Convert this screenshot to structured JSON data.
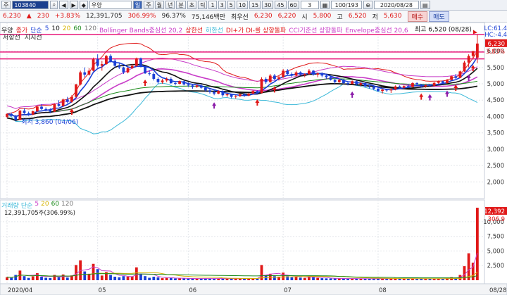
{
  "toolbar": {
    "code": "103840",
    "market_label": "주",
    "name": "우양",
    "period_active": "일",
    "periods": [
      "주",
      "월",
      "년",
      "분",
      "초",
      "틱"
    ],
    "intervals": [
      "1",
      "3",
      "5",
      "10",
      "15",
      "30",
      "45",
      "60"
    ],
    "count": "3",
    "page": "100/193",
    "date": "2020/08/28",
    "nav_tools": [
      "◀",
      "▶",
      "◆",
      "⊕"
    ]
  },
  "price": {
    "current": "6,230",
    "change_arrow": "▲",
    "change": "230",
    "change_pct": "+3.83%",
    "volume": "12,391,705",
    "volume_ratio": "306.99%",
    "strength": "96.37%",
    "amount": "75,146백만",
    "best_sell_label": "최우선",
    "best_sell": "6,230",
    "best_buy": "6,220",
    "open_label": "시",
    "open": "5,800",
    "high_label": "고",
    "high": "6,520",
    "low_label": "저",
    "low": "5,630",
    "buy_button": "매수",
    "sell_button": "매도"
  },
  "legend": {
    "name": "우양",
    "items": [
      {
        "label": "종가",
        "color": "#e01818"
      },
      {
        "label": "단순",
        "color": "#1a3fd6"
      },
      {
        "label": "5",
        "color": "#1a3fd6"
      },
      {
        "label": "10",
        "color": "#111111"
      },
      {
        "label": "20",
        "color": "#d6b300"
      },
      {
        "label": "60",
        "color": "#1b8a1b"
      },
      {
        "label": "120",
        "color": "#777777"
      },
      {
        "label": "Bollinger Bands중심선 20,2",
        "color": "#c83cc8"
      },
      {
        "label": "상한선",
        "color": "#e01818"
      },
      {
        "label": "하한선",
        "color": "#3ab8d8"
      },
      {
        "label": "DI+가 DI-를 상향돌파",
        "color": "#e01818"
      },
      {
        "label": "CCI기준선 상향돌파",
        "color": "#c83cc8"
      },
      {
        "label": "Envelope중심선 20,6",
        "color": "#c83cc8"
      }
    ],
    "sub": [
      "저항선",
      "지지선"
    ],
    "right_edge": "LC:61.4",
    "right_edge2": "HC:-4.4"
  },
  "annotations": {
    "high_label": "최고 6,520 (08/28)",
    "low_label": "최저 3,860 (04/06)",
    "price_tag": "6,230",
    "pct_tag": "3.83%"
  },
  "y_axis": {
    "price_ticks": [
      "6,000",
      "5,500",
      "5,000",
      "4,500",
      "4,000",
      "3,500",
      "3,000",
      "2,500",
      "2,000"
    ],
    "volume_ticks": [
      "10,000",
      "7,500",
      "5,000",
      "2,500"
    ],
    "volume_tag": "12,392",
    "volume_pct_tag": "306.9"
  },
  "x_axis": {
    "ticks": [
      "2020/04",
      "05",
      "06",
      "07",
      "08",
      "08/28"
    ]
  },
  "volume_legend": {
    "items": [
      {
        "label": "거래량",
        "color": "#3ab8d8"
      },
      {
        "label": "단순",
        "color": "#3ab8d8"
      },
      {
        "label": "5",
        "color": "#c83cc8"
      },
      {
        "label": "20",
        "color": "#d6b300"
      },
      {
        "label": "60",
        "color": "#1b8a1b"
      },
      {
        "label": "120",
        "color": "#777777"
      }
    ],
    "value": "12,391,705주(306.99%)"
  },
  "chart_data": {
    "type": "candlestick",
    "x_start": "2020/04/01",
    "x_end": "2020/08/28",
    "ylim": [
      1600,
      6700
    ],
    "volume_ylim": [
      0,
      13000
    ],
    "candles": [
      [
        3990,
        4100,
        3950,
        4080,
        "up",
        520
      ],
      [
        4080,
        4120,
        4000,
        4020,
        "down",
        410
      ],
      [
        4020,
        4050,
        3860,
        3900,
        "down",
        900
      ],
      [
        3900,
        4200,
        3880,
        4180,
        "up",
        1650
      ],
      [
        4180,
        4260,
        4080,
        4100,
        "down",
        700
      ],
      [
        4100,
        4150,
        4020,
        4060,
        "down",
        400
      ],
      [
        4060,
        4180,
        4040,
        4160,
        "up",
        650
      ],
      [
        4160,
        4330,
        4140,
        4300,
        "up",
        1200
      ],
      [
        4300,
        4380,
        4200,
        4230,
        "down",
        600
      ],
      [
        4230,
        4280,
        4150,
        4200,
        "down",
        420
      ],
      [
        4200,
        4250,
        4100,
        4150,
        "down",
        380
      ],
      [
        4150,
        4400,
        4140,
        4380,
        "up",
        900
      ],
      [
        4380,
        4500,
        4300,
        4320,
        "down",
        520
      ],
      [
        4320,
        4550,
        4300,
        4520,
        "up",
        980
      ],
      [
        4520,
        4600,
        4400,
        4450,
        "down",
        450
      ],
      [
        4450,
        4650,
        4420,
        4600,
        "up",
        820
      ],
      [
        4600,
        5000,
        4580,
        4980,
        "up",
        2600
      ],
      [
        4980,
        5400,
        4950,
        5350,
        "up",
        3400
      ],
      [
        5350,
        5500,
        5200,
        5280,
        "down",
        1500
      ],
      [
        5280,
        5480,
        5250,
        5400,
        "up",
        1100
      ],
      [
        5400,
        5800,
        5380,
        5750,
        "up",
        2800
      ],
      [
        5750,
        5900,
        5500,
        5550,
        "down",
        1900
      ],
      [
        5550,
        5700,
        5400,
        5600,
        "up",
        800
      ],
      [
        5600,
        5880,
        5580,
        5850,
        "up",
        1400
      ],
      [
        5850,
        5900,
        5650,
        5700,
        "down",
        900
      ],
      [
        5700,
        5750,
        5500,
        5550,
        "down",
        600
      ],
      [
        5550,
        5650,
        5450,
        5500,
        "down",
        500
      ],
      [
        5500,
        5520,
        5300,
        5350,
        "down",
        700
      ],
      [
        5350,
        5500,
        5320,
        5480,
        "up",
        600
      ],
      [
        5480,
        5600,
        5450,
        5550,
        "up",
        650
      ],
      [
        5550,
        5800,
        5520,
        5780,
        "up",
        2200
      ],
      [
        5780,
        5800,
        5500,
        5520,
        "down",
        1100
      ],
      [
        5520,
        5550,
        5300,
        5320,
        "down",
        700
      ],
      [
        5320,
        5420,
        5250,
        5300,
        "down",
        420
      ],
      [
        5300,
        5350,
        5100,
        5150,
        "down",
        600
      ],
      [
        5150,
        5200,
        5000,
        5050,
        "down",
        480
      ],
      [
        5050,
        5150,
        5000,
        5100,
        "up",
        350
      ],
      [
        5100,
        5200,
        5050,
        5150,
        "up",
        400
      ],
      [
        5150,
        5200,
        5000,
        5020,
        "down",
        380
      ],
      [
        5020,
        5080,
        4950,
        5000,
        "down",
        300
      ],
      [
        5000,
        5100,
        4980,
        5080,
        "up",
        320
      ],
      [
        5080,
        5100,
        4950,
        4980,
        "down",
        300
      ],
      [
        4980,
        5050,
        4900,
        4950,
        "down",
        280
      ],
      [
        4950,
        5000,
        4850,
        4900,
        "down",
        300
      ],
      [
        4900,
        4980,
        4880,
        4950,
        "up",
        260
      ],
      [
        4950,
        5000,
        4850,
        4880,
        "down",
        280
      ],
      [
        4880,
        4900,
        4750,
        4800,
        "down",
        320
      ],
      [
        4800,
        4850,
        4700,
        4750,
        "down",
        260
      ],
      [
        4750,
        4800,
        4650,
        4700,
        "down",
        300
      ],
      [
        4700,
        4800,
        4680,
        4780,
        "up",
        280
      ],
      [
        4780,
        4800,
        4600,
        4650,
        "down",
        310
      ],
      [
        4650,
        4700,
        4600,
        4680,
        "up",
        260
      ],
      [
        4680,
        4700,
        4550,
        4600,
        "down",
        280
      ],
      [
        4600,
        4650,
        4550,
        4620,
        "up",
        250
      ],
      [
        4620,
        4700,
        4600,
        4680,
        "up",
        300
      ],
      [
        4680,
        4720,
        4600,
        4640,
        "down",
        260
      ],
      [
        4640,
        4720,
        4620,
        4700,
        "up",
        280
      ],
      [
        4700,
        4800,
        4680,
        4780,
        "up",
        350
      ],
      [
        4780,
        4800,
        4700,
        4720,
        "down",
        280
      ],
      [
        4720,
        5200,
        4700,
        5150,
        "up",
        2600
      ],
      [
        5150,
        5200,
        5000,
        5050,
        "down",
        900
      ],
      [
        5050,
        5300,
        5030,
        5250,
        "up",
        1100
      ],
      [
        5250,
        5300,
        5100,
        5150,
        "down",
        700
      ],
      [
        5150,
        5250,
        5100,
        5200,
        "up",
        600
      ],
      [
        5200,
        5450,
        5180,
        5400,
        "up",
        1300
      ],
      [
        5400,
        5450,
        5250,
        5300,
        "down",
        700
      ],
      [
        5300,
        5350,
        5200,
        5250,
        "down",
        500
      ],
      [
        5250,
        5400,
        5230,
        5350,
        "up",
        600
      ],
      [
        5350,
        5380,
        5250,
        5280,
        "down",
        450
      ],
      [
        5280,
        5320,
        5200,
        5300,
        "up",
        380
      ],
      [
        5300,
        5450,
        5280,
        5400,
        "up",
        800
      ],
      [
        5400,
        5420,
        5250,
        5280,
        "down",
        500
      ],
      [
        5280,
        5350,
        5200,
        5320,
        "up",
        400
      ],
      [
        5320,
        5350,
        5200,
        5250,
        "down",
        350
      ],
      [
        5250,
        5300,
        5150,
        5200,
        "down",
        320
      ],
      [
        5200,
        5250,
        5100,
        5120,
        "down",
        300
      ],
      [
        5120,
        5150,
        5000,
        5050,
        "down",
        320
      ],
      [
        5050,
        5150,
        5030,
        5120,
        "up",
        280
      ],
      [
        5120,
        5150,
        5000,
        5020,
        "down",
        300
      ],
      [
        5020,
        5080,
        4950,
        5000,
        "down",
        260
      ],
      [
        5000,
        5100,
        4980,
        5080,
        "up",
        300
      ],
      [
        5080,
        5100,
        4950,
        4980,
        "down",
        260
      ],
      [
        4980,
        5050,
        4920,
        5020,
        "up",
        240
      ],
      [
        5020,
        5050,
        4900,
        4920,
        "down",
        260
      ],
      [
        4920,
        4950,
        4850,
        4900,
        "down",
        240
      ],
      [
        4900,
        4950,
        4800,
        4850,
        "down",
        260
      ],
      [
        4850,
        4900,
        4750,
        4780,
        "down",
        280
      ],
      [
        4780,
        4850,
        4700,
        4820,
        "up",
        300
      ],
      [
        4820,
        4850,
        4750,
        4800,
        "down",
        220
      ],
      [
        4800,
        4850,
        4720,
        4830,
        "up",
        240
      ],
      [
        4830,
        4950,
        4800,
        4920,
        "up",
        380
      ],
      [
        4920,
        4950,
        4850,
        4880,
        "down",
        260
      ],
      [
        4880,
        4950,
        4860,
        4930,
        "up",
        240
      ],
      [
        4930,
        5000,
        4880,
        4900,
        "down",
        260
      ],
      [
        4900,
        5050,
        4890,
        5020,
        "up",
        320
      ],
      [
        5020,
        5050,
        4950,
        4980,
        "down",
        240
      ],
      [
        4980,
        5000,
        4880,
        4920,
        "down",
        260
      ],
      [
        4920,
        4980,
        4880,
        4960,
        "up",
        220
      ],
      [
        4960,
        5000,
        4900,
        4940,
        "down",
        220
      ],
      [
        4940,
        5050,
        4920,
        5030,
        "up",
        280
      ],
      [
        5030,
        5100,
        5000,
        5080,
        "up",
        300
      ],
      [
        5080,
        5100,
        5000,
        5020,
        "down",
        240
      ],
      [
        5020,
        5150,
        5010,
        5120,
        "up",
        360
      ],
      [
        5120,
        5250,
        5100,
        5230,
        "up",
        520
      ],
      [
        5230,
        5300,
        5150,
        5180,
        "down",
        420
      ],
      [
        5180,
        5400,
        5170,
        5380,
        "up",
        900
      ],
      [
        5380,
        5700,
        5360,
        5650,
        "up",
        2400
      ],
      [
        5650,
        5900,
        5500,
        5850,
        "up",
        4600
      ],
      [
        5850,
        6000,
        5750,
        6000,
        "up",
        3000
      ],
      [
        5800,
        6520,
        5630,
        6230,
        "up",
        12392
      ]
    ]
  }
}
